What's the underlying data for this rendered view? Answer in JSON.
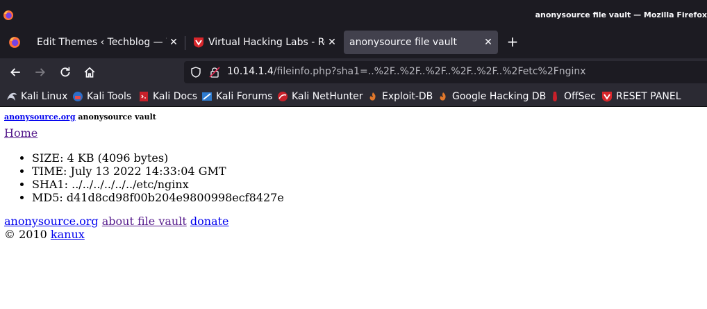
{
  "window": {
    "title": "anonysource file vault — Mozilla Firefox"
  },
  "tabs": [
    {
      "label": "Edit Themes ‹ Techblog — WordPress",
      "favicon": "wordpress-icon",
      "active": false
    },
    {
      "label": "Virtual Hacking Labs - Reset",
      "favicon": "vhl-shield-icon",
      "active": false
    },
    {
      "label": "anonysource file vault",
      "favicon": "",
      "active": true
    }
  ],
  "navbar": {
    "url_host": "10.14.1.4",
    "url_rest": "/fileinfo.php?sha1=..%2F..%2F..%2F..%2F..%2F..%2Fetc%2Fnginx"
  },
  "bookmarks": [
    {
      "label": "Kali Linux",
      "icon": "kali-dragon-icon"
    },
    {
      "label": "Kali Tools",
      "icon": "kali-tools-icon"
    },
    {
      "label": "Kali Docs",
      "icon": "kali-docs-icon"
    },
    {
      "label": "Kali Forums",
      "icon": "kali-forums-icon"
    },
    {
      "label": "Kali NetHunter",
      "icon": "kali-nethunter-icon"
    },
    {
      "label": "Exploit-DB",
      "icon": "exploit-db-icon"
    },
    {
      "label": "Google Hacking DB",
      "icon": "ghdb-icon"
    },
    {
      "label": "OffSec",
      "icon": "offsec-icon"
    },
    {
      "label": "RESET PANEL",
      "icon": "vhl-shield-icon"
    }
  ],
  "page": {
    "header_link": "anonysource.org",
    "header_text": "anonysource vault",
    "home_link": "Home",
    "info": [
      "SIZE: 4 KB (4096 bytes)",
      "TIME: July 13 2022 14:33:04 GMT",
      "SHA1: ../../../../../../etc/nginx",
      "MD5: d41d8cd98f00b204e9800998ecf8427e"
    ],
    "footer_links": [
      "anonysource.org",
      "about file vault",
      "donate"
    ],
    "copyright_symbol": "©",
    "copyright_year": "2010",
    "copyright_link": "kanux"
  },
  "colors": {
    "titlebar_bg": "#1c1b22",
    "toolbar_bg": "#2b2a33",
    "active_tab_bg": "#42414d",
    "link": "#0000ee",
    "visited_link": "#551a8b"
  }
}
